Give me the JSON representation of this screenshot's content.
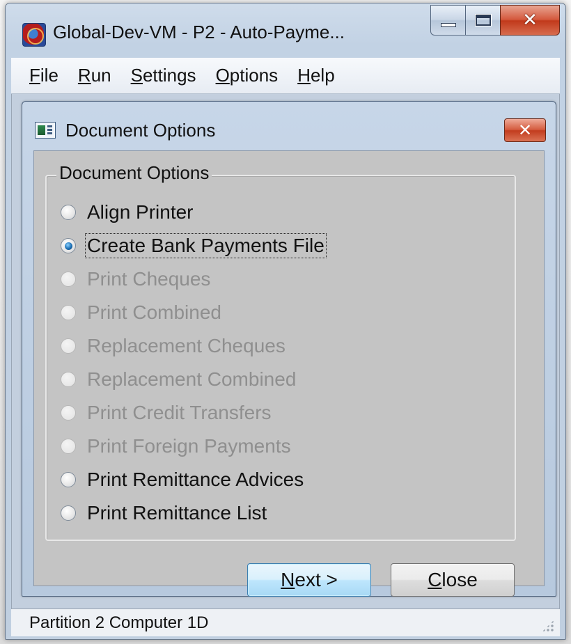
{
  "window": {
    "title": "Global-Dev-VM - P2 - Auto-Payme...",
    "icon": "app-globe-icon",
    "caption_buttons": [
      "minimize",
      "maximize",
      "close"
    ]
  },
  "menubar": {
    "items": [
      {
        "label": "File"
      },
      {
        "label": "Run"
      },
      {
        "label": "Settings"
      },
      {
        "label": "Options"
      },
      {
        "label": "Help"
      }
    ]
  },
  "dialog": {
    "title": "Document Options",
    "icon": "document-options-icon",
    "group_title": "Document Options",
    "options": [
      {
        "label": "Align Printer",
        "enabled": true,
        "checked": false
      },
      {
        "label": "Create Bank Payments File",
        "enabled": true,
        "checked": true
      },
      {
        "label": "Print Cheques",
        "enabled": false,
        "checked": false
      },
      {
        "label": "Print Combined",
        "enabled": false,
        "checked": false
      },
      {
        "label": "Replacement Cheques",
        "enabled": false,
        "checked": false
      },
      {
        "label": "Replacement Combined",
        "enabled": false,
        "checked": false
      },
      {
        "label": "Print Credit Transfers",
        "enabled": false,
        "checked": false
      },
      {
        "label": "Print Foreign Payments",
        "enabled": false,
        "checked": false
      },
      {
        "label": "Print Remittance Advices",
        "enabled": true,
        "checked": false
      },
      {
        "label": "Print Remittance List",
        "enabled": true,
        "checked": false
      }
    ],
    "next_button": "Next >",
    "close_button": "Close"
  },
  "statusbar": {
    "text": "Partition 2 Computer 1D"
  },
  "colors": {
    "accent_blue": "#1c6fb4",
    "close_red": "#c23c1e",
    "disabled_text": "#8f8f8f"
  }
}
